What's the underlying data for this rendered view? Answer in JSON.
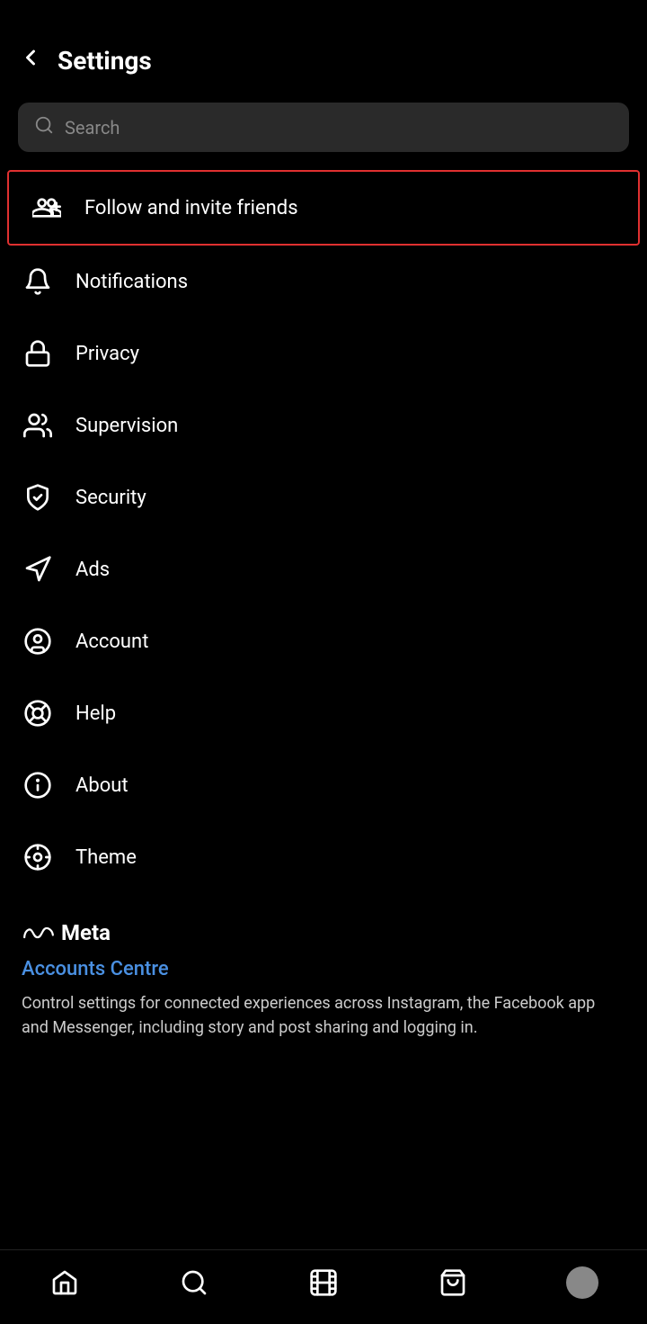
{
  "header": {
    "title": "Settings",
    "back_label": "Back"
  },
  "search": {
    "placeholder": "Search"
  },
  "menu_items": [
    {
      "id": "follow-friends",
      "label": "Follow and invite friends",
      "icon": "add-person",
      "highlighted": true
    },
    {
      "id": "notifications",
      "label": "Notifications",
      "icon": "bell"
    },
    {
      "id": "privacy",
      "label": "Privacy",
      "icon": "lock"
    },
    {
      "id": "supervision",
      "label": "Supervision",
      "icon": "people"
    },
    {
      "id": "security",
      "label": "Security",
      "icon": "shield"
    },
    {
      "id": "ads",
      "label": "Ads",
      "icon": "megaphone"
    },
    {
      "id": "account",
      "label": "Account",
      "icon": "person-circle"
    },
    {
      "id": "help",
      "label": "Help",
      "icon": "lifebuoy"
    },
    {
      "id": "about",
      "label": "About",
      "icon": "info-circle"
    },
    {
      "id": "theme",
      "label": "Theme",
      "icon": "palette"
    }
  ],
  "meta_section": {
    "logo_text": "Meta",
    "accounts_centre_label": "Accounts Centre",
    "description": "Control settings for connected experiences across Instagram, the Facebook app and Messenger, including story and post sharing and logging in."
  },
  "bottom_nav": {
    "items": [
      "home",
      "search",
      "reels",
      "shop",
      "profile"
    ]
  }
}
